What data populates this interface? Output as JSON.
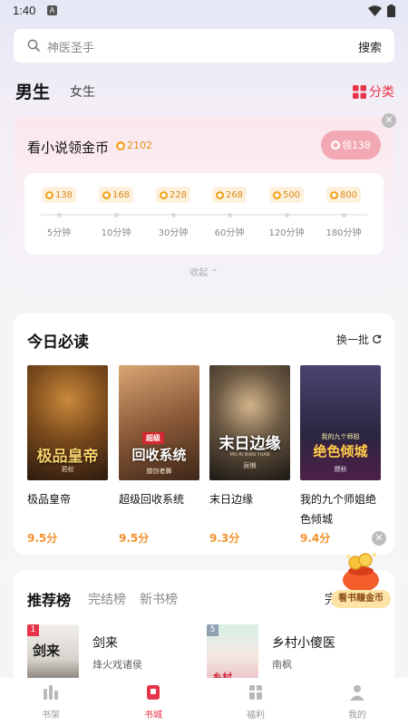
{
  "status_bar": {
    "time": "1:40",
    "notification_glyph": "A"
  },
  "search": {
    "placeholder": "神医圣手",
    "button_label": "搜索"
  },
  "gender_tabs": [
    {
      "label": "男生"
    },
    {
      "label": "女生"
    }
  ],
  "category_link": "分类",
  "coin_task": {
    "title": "看小说领金币",
    "balance": "2102",
    "claim_label": "领138",
    "rewards": [
      {
        "coins": "138",
        "time": "5分钟"
      },
      {
        "coins": "168",
        "time": "10分钟"
      },
      {
        "coins": "228",
        "time": "30分钟"
      },
      {
        "coins": "268",
        "time": "60分钟"
      },
      {
        "coins": "500",
        "time": "120分钟"
      },
      {
        "coins": "800",
        "time": "180分钟"
      }
    ],
    "collapse_label": "收起"
  },
  "daily_read": {
    "title": "今日必读",
    "refresh_label": "换一批",
    "books": [
      {
        "title": "极品皇帝",
        "score": "9.5分",
        "cover_text": "极品皇帝",
        "cover_author": "君权",
        "cover_color": "#5a3a1e"
      },
      {
        "title": "超级回收系统",
        "score": "9.5分",
        "cover_text": "回收系统",
        "cover_banner": "超级",
        "cover_author": "御剑者舞",
        "cover_color": "#6b4530"
      },
      {
        "title": "末日边缘",
        "score": "9.3分",
        "cover_text": "末日边缘",
        "cover_sub": "MO RI BIAN YUAN",
        "cover_author": "辰懒",
        "cover_color": "#2a2520"
      },
      {
        "title": "我的九个师姐绝色倾城",
        "score": "9.4分",
        "cover_text": "绝色倾城",
        "cover_sub": "我的九个师姐",
        "cover_author": "燃秋",
        "cover_color": "#2a2640"
      }
    ]
  },
  "earn_widget": {
    "label": "看书赚金币"
  },
  "ranking": {
    "tabs": [
      {
        "label": "推荐榜"
      },
      {
        "label": "完结榜"
      },
      {
        "label": "新书榜"
      },
      {
        "label": "完"
      }
    ],
    "items": [
      {
        "rank": "1",
        "title": "剑来",
        "author": "烽火戏诸侯",
        "cover_text": "剑来"
      },
      {
        "rank": "5",
        "title": "乡村小傻医",
        "author": "南枫",
        "cover_text": "乡村"
      }
    ]
  },
  "tab_bar": [
    {
      "label": "书架",
      "icon": "bookshelf-icon"
    },
    {
      "label": "书城",
      "icon": "bookstore-icon",
      "active": true
    },
    {
      "label": "福利",
      "icon": "gift-icon"
    },
    {
      "label": "我的",
      "icon": "profile-icon"
    }
  ],
  "colors": {
    "accent": "#e8344a",
    "coin": "#f0a21b",
    "score": "#f2912e"
  }
}
